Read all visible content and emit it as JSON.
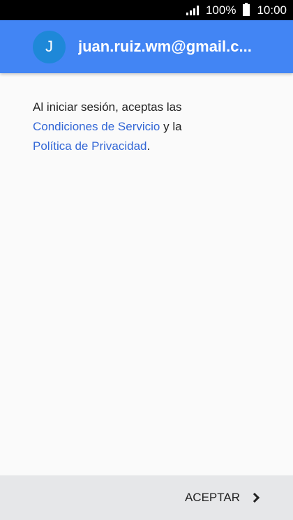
{
  "status_bar": {
    "battery_percent": "100%",
    "time": "10:00"
  },
  "header": {
    "avatar_initial": "J",
    "account_email": "juan.ruiz.wm@gmail.c..."
  },
  "content": {
    "text_before": "Al iniciar sesión, aceptas las",
    "terms_link": "Condiciones de Servicio",
    "connector": " y la",
    "privacy_link": "Política de Privacidad",
    "period": "."
  },
  "footer": {
    "accept_label": "ACEPTAR"
  }
}
